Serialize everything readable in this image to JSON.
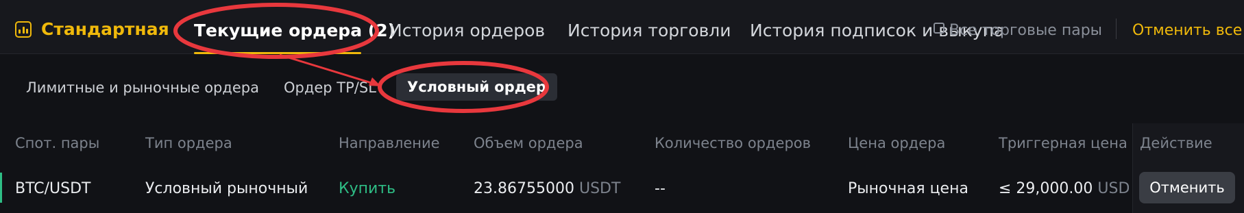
{
  "colors": {
    "accent": "#f0b90b",
    "buy": "#2ebd85",
    "annotation": "#e8383d",
    "background": "#111216"
  },
  "header": {
    "mode_label": "Стандартная",
    "mode_icon": "bar-chart-icon",
    "tabs": [
      {
        "label": "Текущие ордера (2)",
        "active": true
      },
      {
        "label": "История ордеров"
      },
      {
        "label": "История торговли"
      },
      {
        "label": "История подписок и выкупа"
      }
    ],
    "all_pairs_label": "Все торговые пары",
    "cancel_all_label": "Отменить все"
  },
  "subtabs": [
    {
      "label": "Лимитные и рыночные ордера"
    },
    {
      "label": "Ордер TP/SL"
    },
    {
      "label": "Условный ордер",
      "active": true
    }
  ],
  "table": {
    "columns": [
      "Спот. пары",
      "Тип ордера",
      "Направление",
      "Объем ордера",
      "Количество ордеров",
      "Цена ордера",
      "Триггерная цена",
      "Действие"
    ],
    "rows": [
      {
        "pair": "BTC/USDT",
        "type": "Условный рыночный",
        "side": "Купить",
        "volume": "23.86755000",
        "volume_unit": "USDT",
        "quantity": "--",
        "price": "Рыночная цена",
        "trigger": "≤ 29,000.00",
        "trigger_unit": "USDT",
        "action": "Отменить"
      }
    ]
  }
}
